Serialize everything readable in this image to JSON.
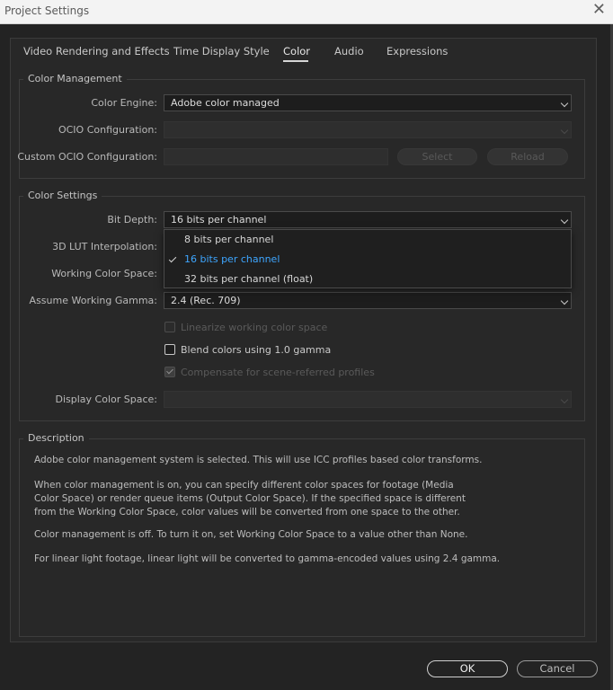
{
  "window": {
    "title": "Project Settings"
  },
  "tabs": [
    "Video Rendering and Effects",
    "Time Display Style",
    "Color",
    "Audio",
    "Expressions"
  ],
  "active_tab": "Color",
  "color_management": {
    "legend": "Color Management",
    "color_engine": {
      "label": "Color Engine:",
      "value": "Adobe color managed"
    },
    "ocio_configuration": {
      "label": "OCIO Configuration:",
      "value": ""
    },
    "custom_ocio": {
      "label": "Custom OCIO Configuration:",
      "value": "",
      "select_label": "Select",
      "reload_label": "Reload"
    }
  },
  "color_settings": {
    "legend": "Color Settings",
    "bit_depth": {
      "label": "Bit Depth:",
      "value": "16 bits per channel"
    },
    "lut_interpolation": {
      "label": "3D LUT Interpolation:"
    },
    "working_color_space": {
      "label": "Working Color Space:"
    },
    "working_gamma": {
      "label": "Assume Working Gamma:",
      "value": "2.4 (Rec. 709)"
    },
    "linearize": {
      "label": "Linearize working color space",
      "checked": false,
      "enabled": false
    },
    "blend_gamma": {
      "label": "Blend colors using 1.0 gamma",
      "checked": false,
      "enabled": true
    },
    "compensate": {
      "label": "Compensate for scene-referred profiles",
      "checked": true,
      "enabled": false
    },
    "display_color_space": {
      "label": "Display Color Space:",
      "value": ""
    }
  },
  "bit_depth_dropdown": {
    "options": [
      "8 bits per channel",
      "16 bits per channel",
      "32 bits per channel (float)"
    ],
    "selected": "16 bits per channel"
  },
  "description": {
    "legend": "Description",
    "paragraphs": [
      "Adobe color management system is selected. This will use ICC profiles based color transforms.",
      "When color management is on, you can specify different color spaces for footage (Media Color Space) or render queue items (Output Color Space). If the specified space is different from the Working Color Space, color values will be converted from one space to the other.",
      "Color management is off. To turn it on, set Working Color Space to a value other than None.",
      "For linear light footage, linear light will be converted to gamma-encoded values using 2.4 gamma."
    ]
  },
  "buttons": {
    "ok": "OK",
    "cancel": "Cancel"
  },
  "colors": {
    "accent": "#3ea6ff",
    "background": "#232323",
    "panel": "#282828"
  }
}
